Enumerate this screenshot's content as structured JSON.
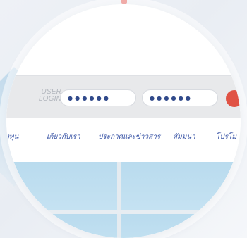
{
  "login": {
    "label": "USER LOGIN",
    "username_value": "●●●●●●",
    "password_value": "●●●●●●",
    "submit_color": "#e05244"
  },
  "nav": {
    "items": [
      "งทุน",
      "เกี่ยวกับเรา",
      "ประกาศและข่าวสาร",
      "สัมมนา",
      "โปรโม"
    ]
  },
  "theme": {
    "nav_color": "#3b56a7",
    "accent_red": "#e05244",
    "panel_blue": "#bfdff0"
  }
}
